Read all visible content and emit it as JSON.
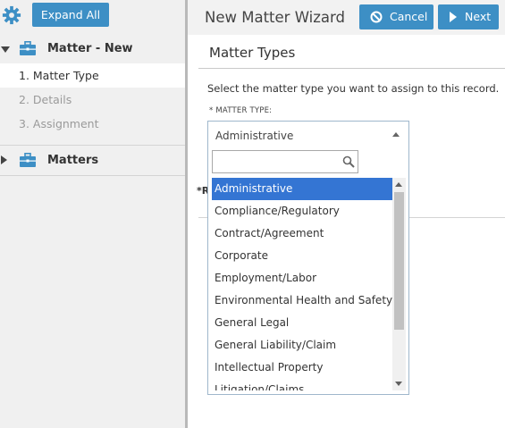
{
  "sidebar": {
    "expand_all_label": "Expand All",
    "gear_icon": "gear-icon",
    "groups": [
      {
        "label": "Matter - New",
        "icon": "briefcase-icon",
        "expanded": true,
        "steps": [
          {
            "label": "1. Matter Type",
            "state": "active"
          },
          {
            "label": "2. Details",
            "state": "disabled"
          },
          {
            "label": "3. Assignment",
            "state": "disabled"
          }
        ]
      },
      {
        "label": "Matters",
        "icon": "briefcase-icon",
        "expanded": false
      }
    ]
  },
  "header": {
    "title": "New Matter Wizard",
    "cancel_label": "Cancel",
    "next_label": "Next"
  },
  "main": {
    "section_title": "Matter Types",
    "instruction": "Select the matter type you want to assign to this record.",
    "field_label": "* MATTER TYPE:",
    "partial_text": "*R"
  },
  "dropdown": {
    "selected_value": "Administrative",
    "search_value": "",
    "options": [
      "Administrative",
      "Compliance/Regulatory",
      "Contract/Agreement",
      "Corporate",
      "Employment/Labor",
      "Environmental Health and Safety",
      "General Legal",
      "General Liability/Claim",
      "Intellectual Property",
      "Litigation/Claims"
    ],
    "highlighted_index": 0
  },
  "colors": {
    "accent": "#3d8fc5",
    "selection": "#3475d3",
    "sidebar_bg": "#f0f0f0"
  }
}
